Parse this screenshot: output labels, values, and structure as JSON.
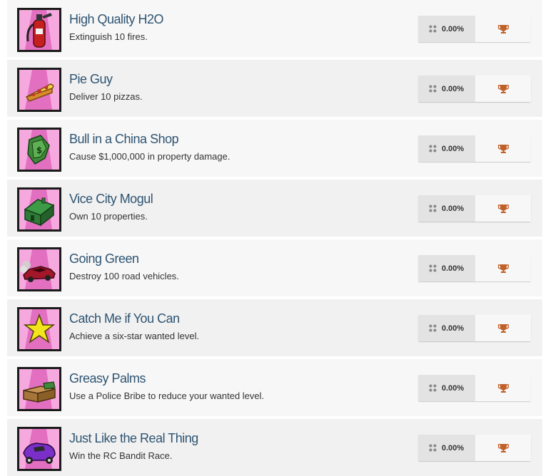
{
  "colors": {
    "title": "#2e5472",
    "trophy_bronze": "#c0612a",
    "badge_pink": "#e26fc0",
    "row_light": "#f7f7f7",
    "row_dark": "#f1f1f1"
  },
  "achievements": [
    {
      "title": "High Quality H2O",
      "description": "Extinguish 10 fires.",
      "percent": "0.00%",
      "icon": "fire-extinguisher-icon",
      "trophy": "bronze-trophy-icon"
    },
    {
      "title": "Pie Guy",
      "description": "Deliver 10 pizzas.",
      "percent": "0.00%",
      "icon": "pizza-slice-icon",
      "trophy": "bronze-trophy-icon"
    },
    {
      "title": "Bull in a China Shop",
      "description": "Cause $1,000,000 in property damage.",
      "percent": "0.00%",
      "icon": "money-cash-icon",
      "trophy": "bronze-trophy-icon"
    },
    {
      "title": "Vice City Mogul",
      "description": "Own 10 properties.",
      "percent": "0.00%",
      "icon": "house-icon",
      "trophy": "bronze-trophy-icon"
    },
    {
      "title": "Going Green",
      "description": "Destroy 100 road vehicles.",
      "percent": "0.00%",
      "icon": "wrecked-car-icon",
      "trophy": "bronze-trophy-icon"
    },
    {
      "title": "Catch Me if You Can",
      "description": "Achieve a six-star wanted level.",
      "percent": "0.00%",
      "icon": "star-icon",
      "trophy": "bronze-trophy-icon"
    },
    {
      "title": "Greasy Palms",
      "description": "Use a Police Bribe to reduce your wanted level.",
      "percent": "0.00%",
      "icon": "bribe-cash-icon",
      "trophy": "bronze-trophy-icon"
    },
    {
      "title": "Just Like the Real Thing",
      "description": "Win the RC Bandit Race.",
      "percent": "0.00%",
      "icon": "rc-car-icon",
      "trophy": "bronze-trophy-icon"
    }
  ]
}
